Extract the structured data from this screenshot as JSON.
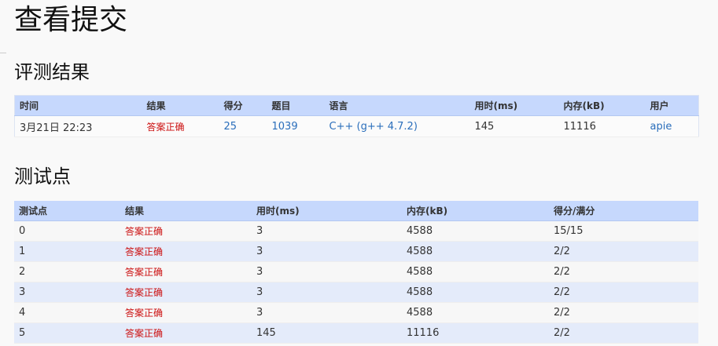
{
  "page_title": "查看提交",
  "result_section": {
    "title": "评测结果",
    "headers": [
      "时间",
      "结果",
      "得分",
      "题目",
      "语言",
      "用时(ms)",
      "内存(kB)",
      "用户"
    ],
    "row": {
      "time": "3月21日 22:23",
      "result": "答案正确",
      "score": "25",
      "problem": "1039",
      "language": "C++ (g++ 4.7.2)",
      "time_ms": "145",
      "memory_kb": "11116",
      "user": "apie"
    }
  },
  "testcase_section": {
    "title": "测试点",
    "headers": [
      "测试点",
      "结果",
      "用时(ms)",
      "内存(kB)",
      "得分/满分"
    ],
    "rows": [
      {
        "case": "0",
        "result": "答案正确",
        "time_ms": "3",
        "memory_kb": "4588",
        "score": "15/15"
      },
      {
        "case": "1",
        "result": "答案正确",
        "time_ms": "3",
        "memory_kb": "4588",
        "score": "2/2"
      },
      {
        "case": "2",
        "result": "答案正确",
        "time_ms": "3",
        "memory_kb": "4588",
        "score": "2/2"
      },
      {
        "case": "3",
        "result": "答案正确",
        "time_ms": "3",
        "memory_kb": "4588",
        "score": "2/2"
      },
      {
        "case": "4",
        "result": "答案正确",
        "time_ms": "3",
        "memory_kb": "4588",
        "score": "2/2"
      },
      {
        "case": "5",
        "result": "答案正确",
        "time_ms": "145",
        "memory_kb": "11116",
        "score": "2/2"
      }
    ]
  },
  "colors": {
    "accepted": "#cc1111",
    "link": "#2a6ebb",
    "header_bg": "#c6d8fd",
    "row_alt_bg": "#e4ebfa"
  }
}
